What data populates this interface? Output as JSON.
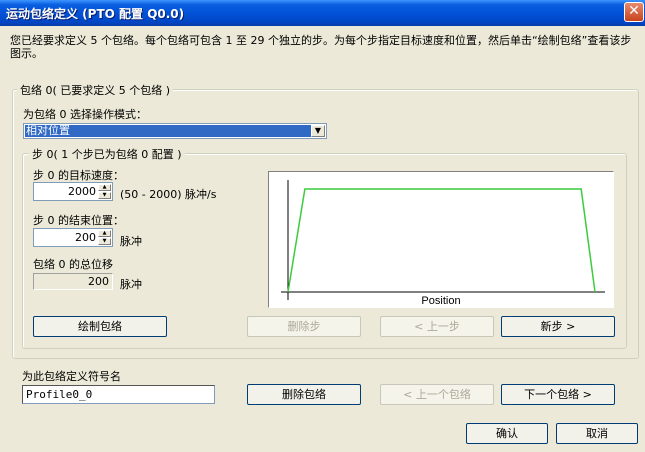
{
  "window": {
    "title": "运动包络定义 (PTO 配置 Q0.0)",
    "close_glyph": "✕"
  },
  "description": "您已经要求定义 5 个包络。每个包络可包含 1 至 29 个独立的步。为每个步指定目标速度和位置，然后单击“绘制包络”查看该步图示。",
  "envelope_group": {
    "legend": "包络 0( 已要求定义 5 个包络 )",
    "mode_label": "为包络 0 选择操作模式：",
    "mode_value": "相对位置",
    "step_group": {
      "legend": "步 0( 1 个步已为包络 0 配置 )",
      "speed_label": "步 0 的目标速度：",
      "speed_value": "2000",
      "speed_unit": "(50 - 2000) 脉冲/s",
      "end_pos_label": "步 0 的结束位置：",
      "end_pos_value": "200",
      "end_pos_unit": "脉冲",
      "total_label": "包络 0 的总位移",
      "total_value": "200",
      "total_unit": "脉冲",
      "draw_button": "绘制包络",
      "delete_step_button": "删除步",
      "prev_step_button": "< 上一步",
      "new_step_button": "新步 >"
    }
  },
  "chart": {
    "xlabel": "Position",
    "line_color": "#3ccc3c"
  },
  "chart_data": {
    "type": "line",
    "xlabel": "Position",
    "ylabel": "",
    "series": [
      {
        "x": [
          0,
          0.055,
          0.955,
          1.0
        ],
        "y": [
          0,
          1,
          1,
          0
        ]
      }
    ]
  },
  "symbol": {
    "label": "为此包络定义符号名",
    "value": "Profile0_0"
  },
  "envelope_nav": {
    "delete_button": "删除包络",
    "prev_button": "< 上一个包络",
    "next_button": "下一个包络 >"
  },
  "footer": {
    "ok_button": "确认",
    "cancel_button": "取消"
  }
}
